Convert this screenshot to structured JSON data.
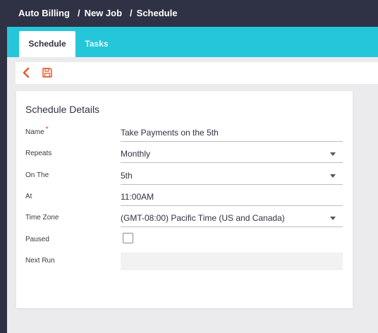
{
  "breadcrumb": {
    "items": [
      "Auto Billing",
      "New Job",
      "Schedule"
    ],
    "separator": "/"
  },
  "tabs": [
    {
      "label": "Schedule",
      "active": true
    },
    {
      "label": "Tasks",
      "active": false
    }
  ],
  "toolbar": {
    "back_icon": "chevron-left-icon",
    "save_icon": "save-icon",
    "accent_color": "#e8572a"
  },
  "form": {
    "title": "Schedule Details",
    "fields": {
      "name": {
        "label": "Name",
        "value": "Take Payments on the 5th",
        "required": true
      },
      "repeats": {
        "label": "Repeats",
        "value": "Monthly"
      },
      "on_the": {
        "label": "On The",
        "value": "5th"
      },
      "at": {
        "label": "At",
        "value": "11:00AM"
      },
      "time_zone": {
        "label": "Time Zone",
        "value": "(GMT-08:00) Pacific Time (US and Canada)"
      },
      "paused": {
        "label": "Paused",
        "checked": false
      },
      "next_run": {
        "label": "Next Run",
        "value": ""
      }
    }
  },
  "colors": {
    "nav_bg": "#2f3244",
    "tab_bar": "#26c6da",
    "page_bg": "#ebebee",
    "required": "#e53935"
  }
}
